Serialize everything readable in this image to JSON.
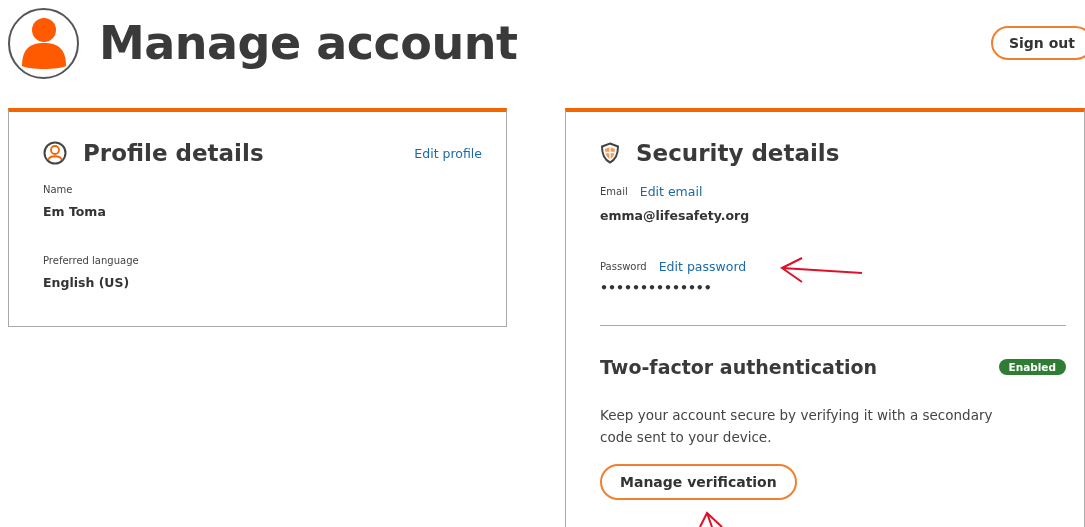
{
  "header": {
    "title": "Manage account",
    "sign_out": "Sign out"
  },
  "profile": {
    "title": "Profile details",
    "edit_link": "Edit profile",
    "fields": [
      {
        "label": "Name",
        "value": "Em Toma"
      },
      {
        "label": "Preferred language",
        "value": "English (US)"
      }
    ]
  },
  "security": {
    "title": "Security details",
    "fields": [
      {
        "label": "Email",
        "link": "Edit email",
        "value": "emma@lifesafety.org"
      },
      {
        "label": "Password",
        "link": "Edit password",
        "value": "••••••••••••••"
      }
    ],
    "two_factor": {
      "title": "Two-factor authentication",
      "badge": "Enabled",
      "enabled": true,
      "description": "Keep your account secure by verifying it with a secondary code sent to your device.",
      "button": "Manage verification"
    }
  }
}
